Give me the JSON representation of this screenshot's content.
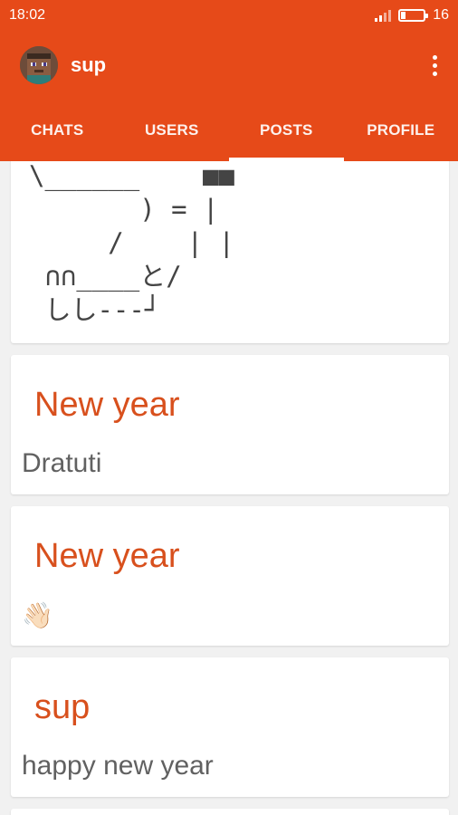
{
  "status_bar": {
    "time": "18:02",
    "battery_level": "16"
  },
  "toolbar": {
    "title": "sup",
    "avatar_icon": "pixel-character-avatar",
    "menu_icon": "overflow-menu-icon"
  },
  "tabs": [
    {
      "label": "CHATS"
    },
    {
      "label": "USERS"
    },
    {
      "label": "POSTS"
    },
    {
      "label": "PROFILE"
    }
  ],
  "active_tab": "POSTS",
  "colors": {
    "accent": "#e64a19",
    "post_title": "#d8501d",
    "body_text": "#616161"
  },
  "posts": [
    {
      "ascii_art": "\\______    ■■\n       ) = |\n     /    | |\n ∩∩____と/\n しし---┘"
    },
    {
      "title": "New year",
      "body": "Dratuti"
    },
    {
      "title": "New year",
      "body": "👋🏻"
    },
    {
      "title": "sup",
      "body": "happy new year"
    }
  ]
}
